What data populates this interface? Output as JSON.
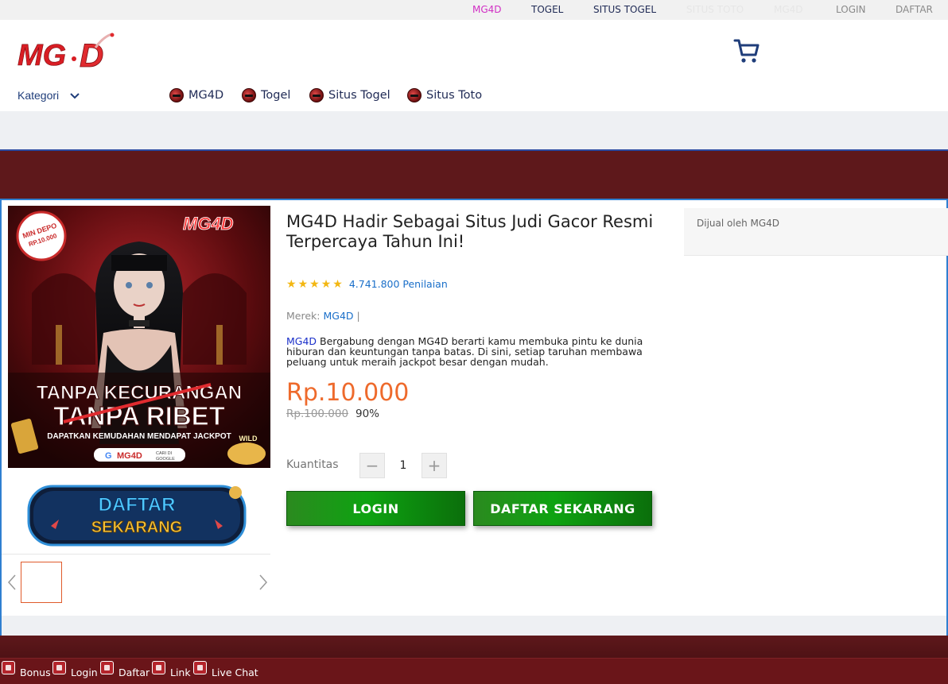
{
  "topbar": {
    "links": [
      {
        "label": "MG4D",
        "color": "#d12fc4"
      },
      {
        "label": "TOGEL",
        "color": "#1f2a55"
      },
      {
        "label": "SITUS TOGEL",
        "color": "#1f2a55"
      },
      {
        "label": "SITUS TOTO",
        "color": "#e6e6e6"
      },
      {
        "label": "MG4D",
        "color": "#e6e6e6"
      },
      {
        "label": "LOGIN",
        "color": "#8a8a8a"
      },
      {
        "label": "DAFTAR",
        "color": "#8a8a8a"
      }
    ]
  },
  "header": {
    "logo_text": "MG4D",
    "kategori_label": "Kategori",
    "nav": [
      {
        "label": "MG4D"
      },
      {
        "label": "Togel"
      },
      {
        "label": "Situs Togel"
      },
      {
        "label": "Situs Toto"
      }
    ]
  },
  "banner": {
    "badge": "MIN DEPO RP.10.000",
    "brand": "MG4D",
    "headline1": "TANPA KECURANGAN",
    "headline2": "TANPA RIBET",
    "subline": "DAPATKAN KEMUDAHAN MENDAPAT JACKPOT",
    "search_hint_brand": "MG4D",
    "search_hint_note": "CARI DI GOOGLE",
    "corner": "WILD"
  },
  "daftar_image": {
    "line1": "DAFTAR",
    "line2": "SEKARANG"
  },
  "product": {
    "title": "MG4D Hadir Sebagai Situs Judi Gacor Resmi Terpercaya Tahun Ini!",
    "rating_stars": 5,
    "rating_text": "4.741.800 Penilaian",
    "brand_label": "Merek:",
    "brand_value": "MG4D",
    "brand_sep": "|",
    "desc_highlight": "MG4D",
    "desc_body": " Bergabung dengan MG4D berarti kamu membuka pintu ke dunia hiburan dan keuntungan tanpa batas. Di sini, setiap taruhan membawa peluang untuk meraih jackpot besar dengan mudah.",
    "price": "Rp.10.000",
    "old_price": "Rp.100.000",
    "discount": "90%",
    "qty_label": "Kuantitas",
    "qty_value": "1",
    "qty_minus": "−",
    "qty_plus": "+",
    "login_label": "LOGIN",
    "daftar_label": "DAFTAR SEKARANG"
  },
  "seller": {
    "label": "Dijual oleh MG4D"
  },
  "bottom_nav": [
    {
      "label": "Bonus",
      "icon": "gift-icon"
    },
    {
      "label": "Login",
      "icon": "home-icon"
    },
    {
      "label": "Daftar",
      "icon": "home-icon"
    },
    {
      "label": "Link",
      "icon": "link-icon"
    },
    {
      "label": "Live Chat",
      "icon": "chat-icon"
    }
  ],
  "colors": {
    "accent": "#ee6a2c",
    "link": "#1a6fc9",
    "maroon": "#5e181b",
    "green": "#0ea311"
  }
}
